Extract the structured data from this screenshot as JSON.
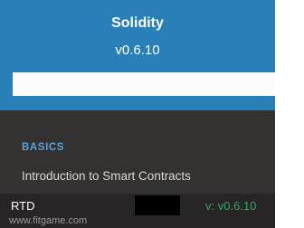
{
  "header": {
    "project_name": "Solidity",
    "version": "v0.6.10"
  },
  "search": {
    "value": "",
    "placeholder": ""
  },
  "navigation": {
    "caption": "BASICS",
    "items": [
      {
        "label": "Introduction to Smart Contracts"
      }
    ]
  },
  "versions_bar": {
    "label": "RTD",
    "current": "v: v0.6.10"
  },
  "watermark": {
    "text": "www.fitgame.com"
  },
  "colors": {
    "header_blue": "#2980b9",
    "sidebar_dark": "#343131",
    "caption_blue": "#55a5d9",
    "version_green": "#27ae60"
  }
}
